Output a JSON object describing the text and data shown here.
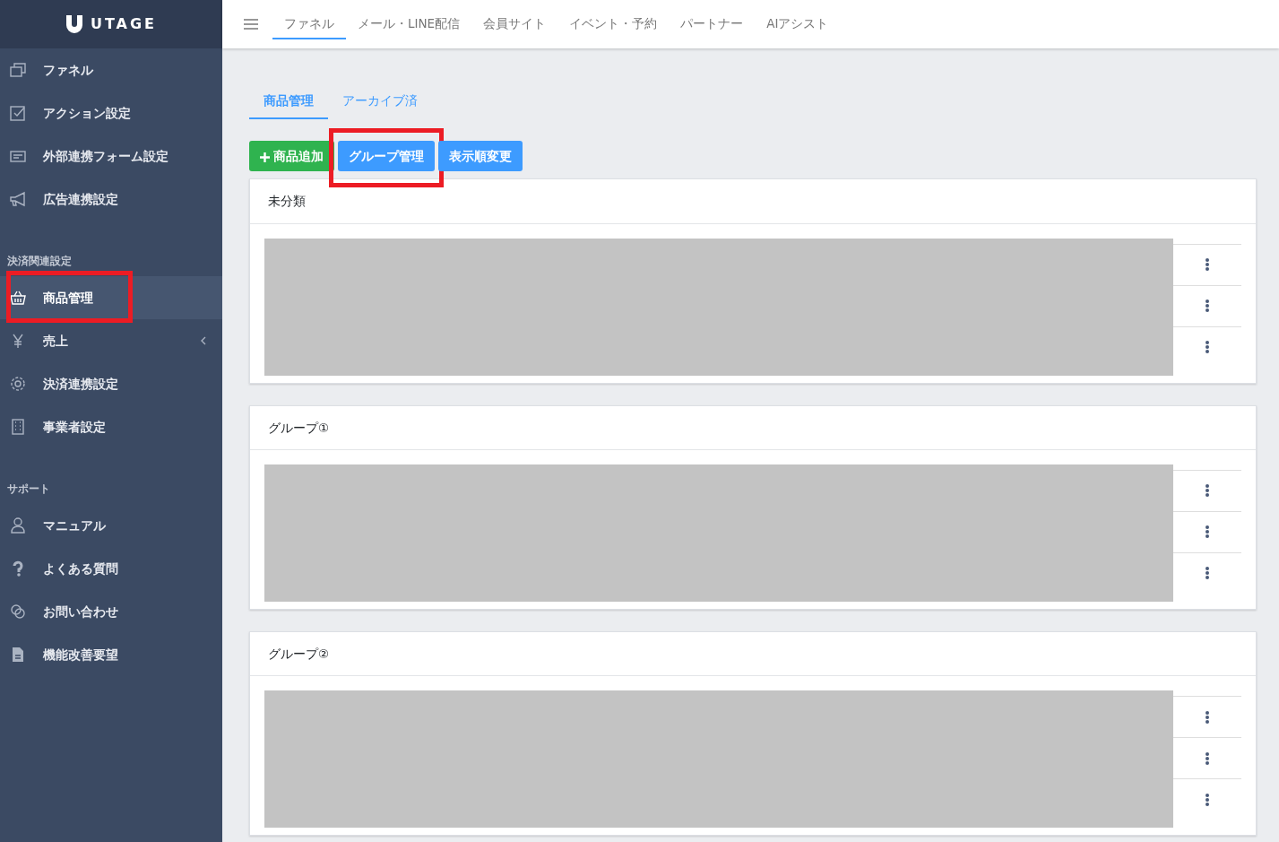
{
  "sidebar": {
    "logo": "UTAGE",
    "sections": [
      {
        "items": [
          {
            "label": "ファネル",
            "selected": false,
            "expandable": false,
            "highlighted": false
          },
          {
            "label": "アクション設定",
            "selected": false,
            "expandable": false,
            "highlighted": false
          },
          {
            "label": "外部連携フォーム設定",
            "selected": false,
            "expandable": false,
            "highlighted": false
          },
          {
            "label": "広告連携設定",
            "selected": false,
            "expandable": false,
            "highlighted": false
          }
        ]
      },
      {
        "heading": "決済関連設定",
        "items": [
          {
            "label": "商品管理",
            "selected": true,
            "expandable": false,
            "highlighted": true
          },
          {
            "label": "売上",
            "selected": false,
            "expandable": true,
            "highlighted": false
          },
          {
            "label": "決済連携設定",
            "selected": false,
            "expandable": false,
            "highlighted": false
          },
          {
            "label": "事業者設定",
            "selected": false,
            "expandable": false,
            "highlighted": false
          }
        ]
      },
      {
        "heading": "サポート",
        "items": [
          {
            "label": "マニュアル",
            "selected": false,
            "expandable": false,
            "highlighted": false
          },
          {
            "label": "よくある質問",
            "selected": false,
            "expandable": false,
            "highlighted": false
          },
          {
            "label": "お問い合わせ",
            "selected": false,
            "expandable": false,
            "highlighted": false
          },
          {
            "label": "機能改善要望",
            "selected": false,
            "expandable": false,
            "highlighted": false
          }
        ]
      }
    ]
  },
  "top_nav": [
    {
      "label": "ファネル",
      "selected": true
    },
    {
      "label": "メール・LINE配信",
      "selected": false
    },
    {
      "label": "会員サイト",
      "selected": false
    },
    {
      "label": "イベント・予約",
      "selected": false
    },
    {
      "label": "パートナー",
      "selected": false
    },
    {
      "label": "AIアシスト",
      "selected": false
    }
  ],
  "tabs": [
    {
      "label": "商品管理",
      "selected": true
    },
    {
      "label": "アーカイブ済",
      "selected": false
    }
  ],
  "buttons": [
    {
      "label": "商品追加",
      "kind": "add",
      "highlighted": false
    },
    {
      "label": "グループ管理",
      "kind": "primary",
      "highlighted": true
    },
    {
      "label": "表示順変更",
      "kind": "primary",
      "highlighted": false
    }
  ],
  "groups": [
    {
      "title": "未分類",
      "rows": [
        {
          "menu": true
        },
        {
          "menu": true
        },
        {
          "menu": true
        }
      ]
    },
    {
      "title": "グループ①",
      "rows": [
        {
          "menu": true
        },
        {
          "menu": true
        },
        {
          "menu": true
        }
      ]
    },
    {
      "title": "グループ②",
      "rows": [
        {
          "menu": true
        },
        {
          "menu": true
        },
        {
          "menu": true
        }
      ]
    }
  ]
}
